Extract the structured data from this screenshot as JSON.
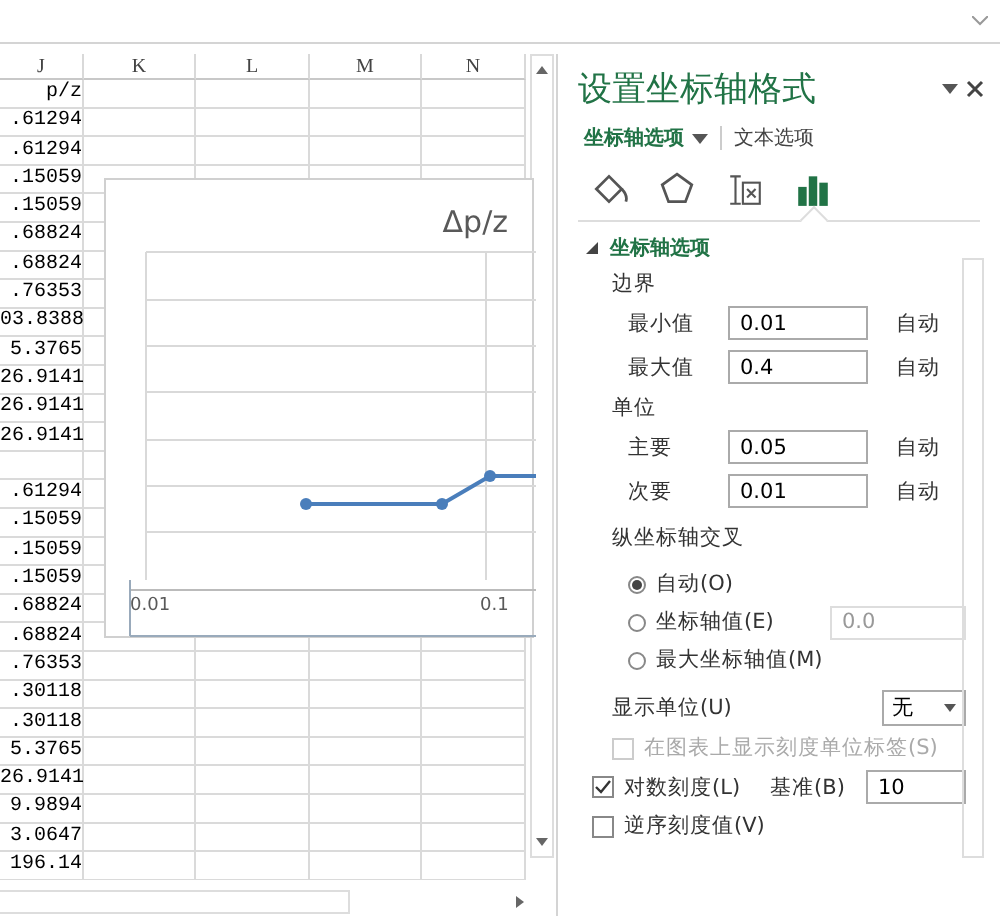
{
  "sheet": {
    "columns": [
      "J",
      "K",
      "L",
      "M",
      "N"
    ],
    "rows": [
      {
        "value": "p/z"
      },
      {
        "value": ".61294"
      },
      {
        "value": ".61294"
      },
      {
        "value": ".15059"
      },
      {
        "value": ".15059"
      },
      {
        "value": ".68824"
      },
      {
        "value": ".68824"
      },
      {
        "value": ".76353"
      },
      {
        "value": "03.8388"
      },
      {
        "value": "5.3765"
      },
      {
        "value": "26.9141"
      },
      {
        "value": "26.9141"
      },
      {
        "value": "26.9141"
      },
      {},
      {
        "value": ".61294"
      },
      {
        "value": ".15059"
      },
      {
        "value": ".15059"
      },
      {
        "value": ".15059"
      },
      {
        "value": ".68824"
      },
      {
        "value": ".68824"
      },
      {
        "value": ".76353"
      },
      {
        "value": ".30118"
      },
      {
        "value": ".30118"
      },
      {
        "value": "5.3765"
      },
      {
        "value": "26.9141"
      },
      {
        "value": "9.9894"
      },
      {
        "value": "3.0647"
      },
      {
        "value": "196.14"
      }
    ],
    "chart": {
      "title": "Δp/z",
      "x_labels": [
        "0.01",
        "0.1"
      ]
    }
  },
  "panel": {
    "title": "设置坐标轴格式",
    "tabs": [
      {
        "label": "坐标轴选项",
        "selected": true
      },
      {
        "label": "文本选项",
        "selected": false
      }
    ],
    "icon_tabs": [
      {
        "kind": "fill",
        "selected": false
      },
      {
        "kind": "effects",
        "selected": false
      },
      {
        "kind": "size",
        "selected": false
      },
      {
        "kind": "axis",
        "selected": true
      }
    ],
    "section": {
      "title": "坐标轴选项",
      "expanded": true
    },
    "groups": [
      {
        "title": "边界",
        "fields": [
          {
            "label": "最小值",
            "value": "0.01",
            "auto": "自动"
          },
          {
            "label": "最大值",
            "value": "0.4",
            "auto": "自动"
          }
        ]
      },
      {
        "title": "单位",
        "fields": [
          {
            "label": "主要",
            "value": "0.05",
            "auto": "自动"
          },
          {
            "label": "次要",
            "value": "0.01",
            "auto": "自动"
          }
        ]
      }
    ],
    "cross": {
      "title": "纵坐标轴交叉",
      "options": [
        {
          "label": "自动(O)",
          "selected": true
        },
        {
          "label": "坐标轴值(E)",
          "selected": false,
          "value": "0.0"
        },
        {
          "label": "最大坐标轴值(M)",
          "selected": false
        }
      ]
    },
    "display_units": {
      "label": "显示单位(U)",
      "value": "无"
    },
    "checks": [
      {
        "kind": "plain",
        "label": "在图表上显示刻度单位标签(S)",
        "checked": false,
        "disabled": true
      },
      {
        "kind": "base",
        "label": "对数刻度(L)",
        "checked": true,
        "disabled": false,
        "base_label": "基准(B)",
        "base_value": "10"
      },
      {
        "kind": "plain",
        "label": "逆序刻度值(V)",
        "checked": false,
        "disabled": false
      }
    ]
  }
}
